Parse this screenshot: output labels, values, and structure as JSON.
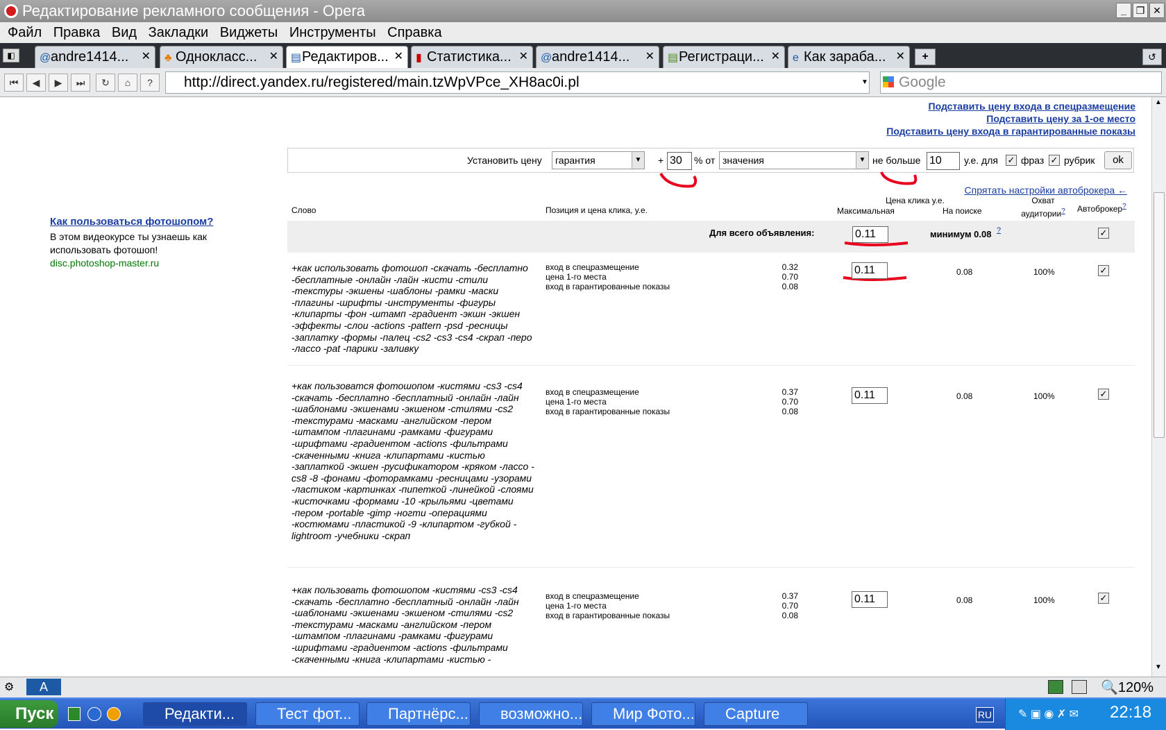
{
  "window": {
    "title": "Редактирование рекламного сообщения - Opera"
  },
  "menu": [
    "Файл",
    "Правка",
    "Вид",
    "Закладки",
    "Виджеты",
    "Инструменты",
    "Справка"
  ],
  "tabs": [
    {
      "label": "andre1414...",
      "icon": "@"
    },
    {
      "label": "Однокласс...",
      "icon": "♣"
    },
    {
      "label": "Редактиров...",
      "icon": "▤"
    },
    {
      "label": "Статистика...",
      "icon": "▮"
    },
    {
      "label": "andre1414...",
      "icon": "@"
    },
    {
      "label": "Регистраци...",
      "icon": "▤"
    },
    {
      "label": "Как зараба...",
      "icon": "e"
    }
  ],
  "address": {
    "url": "http://direct.yandex.ru/registered/main.tzWpVPce_XH8ac0i.pl",
    "search_placeholder": "Google"
  },
  "links": [
    "Подставить цену входа в спецразмещение",
    "Подставить цену за 1-ое место",
    "Подставить цену входа в гарантированные показы"
  ],
  "settings": {
    "label": "Установить цену",
    "select1": "гарантия",
    "plus": "+",
    "percent": "30",
    "pct_from": "% от",
    "select2": "значения",
    "no_more": "не больше",
    "max": "10",
    "units": "у.е. для",
    "phrases": "фраз",
    "rubrics": "рубрик",
    "ok": "ok"
  },
  "hide_link": "Спрятать настройки автоброкера ←",
  "ad": {
    "title": "Как пользоваться фотошопом?",
    "text": "В этом видеокурсе ты узнаешь как использовать фотошоп!",
    "url": "disc.photoshop-master.ru"
  },
  "headers": {
    "word": "Слово",
    "position": "Позиция и цена клика, у.е.",
    "price_group": "Цена клика у.е.",
    "max": "Максимальная",
    "search": "На поиске",
    "reach": "Охват аудитории",
    "reach_q": "?",
    "autobroker": "Автоброкер",
    "auto_q": "?"
  },
  "all": {
    "label": "Для всего объявления:",
    "value": "0.11",
    "min": "минимум 0.08",
    "q": "?"
  },
  "position_labels": [
    "вход в спецразмещение",
    "цена 1-го места",
    "вход в гарантированные показы"
  ],
  "rows": [
    {
      "keyword": "+как использовать фотошоп -скачать -бесплатно -бесплатные -онлайн -лайн -кисти -стили -текстуры -экшены -шаблоны -рамки -маски -плагины -шрифты -инструменты -фигуры -клипарты -фон -штамп -градиент -экшн -экшен -эффекты -слои -actions -pattern -psd -ресницы -заплатку -формы -палец -cs2 -cs3 -cs4 -скрап -перо -лассо -pat -парики -заливку",
      "p1": "0.32",
      "p2": "0.70",
      "p3": "0.08",
      "max": "0.11",
      "search": "0.08",
      "reach": "100%"
    },
    {
      "keyword": "+как пользоватся фотошопом -кистями -cs3 -cs4 -скачать -бесплатно -бесплатный -онлайн -лайн -шаблонами -экшенами -экшеном -стилями -cs2 -текстурами -масками -английском -пером -штампом -плагинами -рамками -фигурами -шрифтами -градиентом -actions -фильтрами -скаченными -книга -клипартами -кистью -заплаткой -экшен -русификатором -кряком -лассо -cs8 -8 -фонами -фоторамками -ресницами -узорами -ластиком -картинках -пипеткой -линейкой -слоями -кисточками -формами -10 -крыльями -цветами -пером -portable -gimp -ногти -операциями -костюмами -пластикой -9 -клипартом -губкой -lightroom -учебники -скрап",
      "p1": "0.37",
      "p2": "0.70",
      "p3": "0.08",
      "max": "0.11",
      "search": "0.08",
      "reach": "100%"
    },
    {
      "keyword": "+как пользовать фотошопом -кистями -cs3 -cs4 -скачать -бесплатно -бесплатный -онлайн -лайн -шаблонами -экшенами -экшеном -стилями -cs2 -текстурами -масками -английском -пером -штампом -плагинами -рамками -фигурами -шрифтами -градиентом -actions -фильтрами -скаченными -книга -клипартами -кистью -",
      "p1": "0.37",
      "p2": "0.70",
      "p3": "0.08",
      "max": "0.11",
      "search": "0.08",
      "reach": "100%"
    }
  ],
  "status": {
    "zoom": "120%"
  },
  "taskbar": {
    "start": "Пуск",
    "buttons": [
      "Редакти...",
      "Тест фот...",
      "Партнёрс...",
      "возможно...",
      "Мир Фото...",
      "Capture"
    ],
    "lang": "RU",
    "time": "22:18"
  },
  "colors": {
    "link": "#1a3da1",
    "annotation": "#e8001c",
    "taskbar": "#2455b8"
  }
}
